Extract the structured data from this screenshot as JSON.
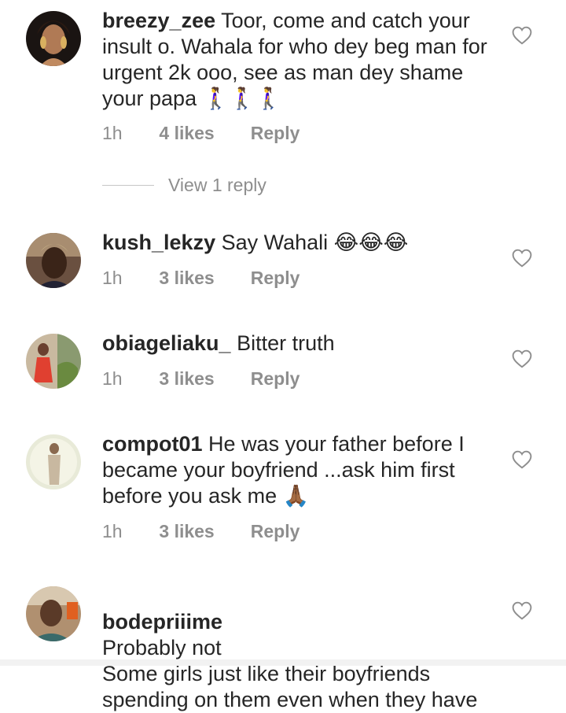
{
  "comments": [
    {
      "username": "breezy_zee",
      "text": "Toor, come and catch your insult o. Wahala for who dey beg man for urgent 2k ooo, see as man dey shame your papa 🚶‍♀️🚶‍♀️🚶‍♀️",
      "time": "1h",
      "likes": "4 likes",
      "reply": "Reply",
      "view_replies": "View 1 reply"
    },
    {
      "username": "kush_lekzy",
      "text": "Say Wahali 😂😂😂",
      "time": "1h",
      "likes": "3 likes",
      "reply": "Reply"
    },
    {
      "username": "obiageliaku_",
      "text": "Bitter truth",
      "time": "1h",
      "likes": "3 likes",
      "reply": "Reply"
    },
    {
      "username": "compot01",
      "text": "He was your father before I became your boyfriend ...ask him first before you ask me 🙏🏾",
      "time": "1h",
      "likes": "3 likes",
      "reply": "Reply"
    },
    {
      "username": "bodepriiime",
      "text": "Probably not\nSome girls just like their boyfriends spending on them even when they have",
      "time": "",
      "likes": "",
      "reply": ""
    }
  ]
}
